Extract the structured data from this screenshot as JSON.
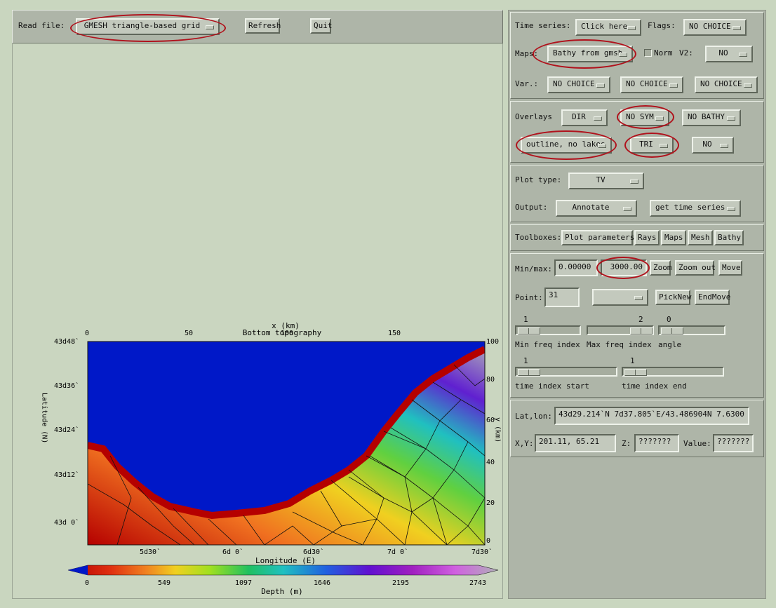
{
  "left_toolbar": {
    "read_file_label": "Read file:",
    "read_file_value": "GMESH triangle-based grid",
    "refresh_label": "Refresh",
    "quit_label": "Quit"
  },
  "time_panel": {
    "time_series_label": "Time series:",
    "time_series_value": "Click here",
    "flags_label": "Flags:",
    "flags_value": "NO CHOICE",
    "maps_label": "Maps:",
    "maps_value": "Bathy from gmsh",
    "norm_label": "Norm",
    "v2_label": "V2:",
    "v2_value": "NO",
    "var_label": "Var.:",
    "var_values": [
      "NO CHOICE",
      "NO CHOICE",
      "NO CHOICE"
    ]
  },
  "overlays": {
    "label": "Overlays",
    "dir_value": "DIR",
    "sym_value": "NO SYM",
    "bathy_value": "NO BATHY",
    "outline_value": "outline, no lakes",
    "tri_value": "TRI",
    "no_value": "NO"
  },
  "plot": {
    "plot_type_label": "Plot type:",
    "plot_type_value": "TV",
    "output_label": "Output:",
    "output_value": "Annotate",
    "get_series_value": "get time series"
  },
  "toolboxes": {
    "label": "Toolboxes:",
    "items": [
      "Plot parameters",
      "Rays",
      "Maps",
      "Mesh",
      "Bathy"
    ]
  },
  "range": {
    "minmax_label": "Min/max:",
    "min_value": "0.00000",
    "max_value": "3000.00",
    "zoom_label": "Zoom",
    "zoom_out_label": "Zoom out",
    "move_label": "Move",
    "point_label": "Point:",
    "point_value": "31",
    "picknew_label": "PickNew",
    "endmove_label": "EndMove",
    "min_freq_value": "1",
    "max_freq_value": "2",
    "angle_value": "0",
    "min_freq_label": "Min freq index",
    "max_freq_label": "Max freq index",
    "angle_label": "angle",
    "time_start_value": "1",
    "time_end_value": "1",
    "time_start_label": "time index start",
    "time_end_label": "time index end"
  },
  "position": {
    "latlon_label": "Lat,lon:",
    "latlon_value": "43d29.214`N   7d37.805`E/43.486904N   7.6300",
    "xy_label": "X,Y:",
    "xy_value": "201.11,    65.21",
    "z_label": "Z:",
    "z_value": "???????",
    "value_label": "Value:",
    "value_value": "???????"
  },
  "chart_data": {
    "type": "heatmap",
    "title": "Bottom topography",
    "xlabel": "Longitude (E)",
    "ylabel": "Latitude (N)",
    "x2label": "x (km)",
    "y2label": "y (km)",
    "x_ticks": [
      "5d30`",
      "6d 0`",
      "6d30`",
      "7d 0`",
      "7d30`"
    ],
    "y_ticks": [
      "43d 0`",
      "43d12`",
      "43d24`",
      "43d36`",
      "43d48`"
    ],
    "x2_ticks": [
      "0",
      "50",
      "100",
      "150"
    ],
    "y2_ticks": [
      "0",
      "20",
      "40",
      "60",
      "80",
      "100"
    ],
    "colorbar_label": "Depth (m)",
    "colorbar_ticks": [
      "0",
      "549",
      "1097",
      "1646",
      "2195",
      "2743"
    ],
    "colorbar_range": [
      0,
      2743
    ],
    "colors": [
      "#b50000",
      "#e03010",
      "#f08020",
      "#f0d020",
      "#a0e020",
      "#20c060",
      "#20c0c0",
      "#2060e0",
      "#6010d0",
      "#a020c0",
      "#d060e0",
      "#b0b0b8"
    ],
    "ocean_color": "#0018c8"
  }
}
